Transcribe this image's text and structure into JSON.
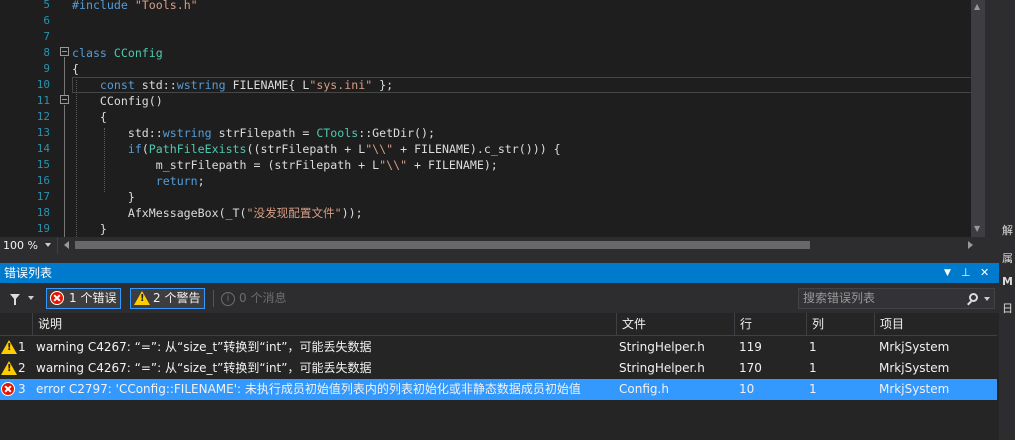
{
  "editor": {
    "lines": [
      {
        "n": "5",
        "text": "#include \"Tools.h\""
      },
      {
        "n": "6",
        "text": ""
      },
      {
        "n": "7",
        "text": ""
      },
      {
        "n": "8",
        "text": "class CConfig"
      },
      {
        "n": "9",
        "text": "{"
      },
      {
        "n": "10",
        "text": "    const std::wstring FILENAME{ L\"sys.ini\" };"
      },
      {
        "n": "11",
        "text": "    CConfig()"
      },
      {
        "n": "12",
        "text": "    {"
      },
      {
        "n": "13",
        "text": "        std::wstring strFilepath = CTools::GetDir();"
      },
      {
        "n": "14",
        "text": "        if(PathFileExists((strFilepath + L\"\\\\\" + FILENAME).c_str())) {"
      },
      {
        "n": "15",
        "text": "            m_strFilepath = (strFilepath + L\"\\\\\" + FILENAME);"
      },
      {
        "n": "16",
        "text": "            return;"
      },
      {
        "n": "17",
        "text": "        }"
      },
      {
        "n": "18",
        "text": "        AfxMessageBox(_T(\"没发现配置文件\"));"
      },
      {
        "n": "19",
        "text": "    }"
      }
    ],
    "zoom": "100 %"
  },
  "side_strip": {
    "glyphs": [
      "解",
      "属",
      "M",
      "日"
    ]
  },
  "error_list": {
    "title": "错误列表",
    "title_buttons": {
      "dropdown": "▼",
      "pin": "⊥",
      "close": "✕"
    },
    "filters": {
      "errors": "1 个错误",
      "warnings": "2 个警告",
      "messages": "0 个消息"
    },
    "search_placeholder": "搜索错误列表",
    "columns": [
      "说明",
      "文件",
      "行",
      "列",
      "项目"
    ],
    "rows": [
      {
        "num": "1",
        "kind": "warning",
        "desc": "warning C4267: “=”: 从“size_t”转换到“int”，可能丢失数据",
        "file": "StringHelper.h",
        "line": "119",
        "col": "1",
        "project": "MrkjSystem"
      },
      {
        "num": "2",
        "kind": "warning",
        "desc": "warning C4267: “=”: 从“size_t”转换到“int”，可能丢失数据",
        "file": "StringHelper.h",
        "line": "170",
        "col": "1",
        "project": "MrkjSystem"
      },
      {
        "num": "3",
        "kind": "error",
        "desc": "error C2797: 'CConfig::FILENAME': 未执行成员初始值列表内的列表初始化或非静态数据成员初始值",
        "file": "Config.h",
        "line": "10",
        "col": "1",
        "project": "MrkjSystem",
        "selected": true
      }
    ]
  },
  "colors": {
    "accent": "#007acc",
    "selection": "#3399ff",
    "error": "#e51400",
    "warning": "#ffcc00",
    "editor_bg": "#1e1e1e"
  }
}
